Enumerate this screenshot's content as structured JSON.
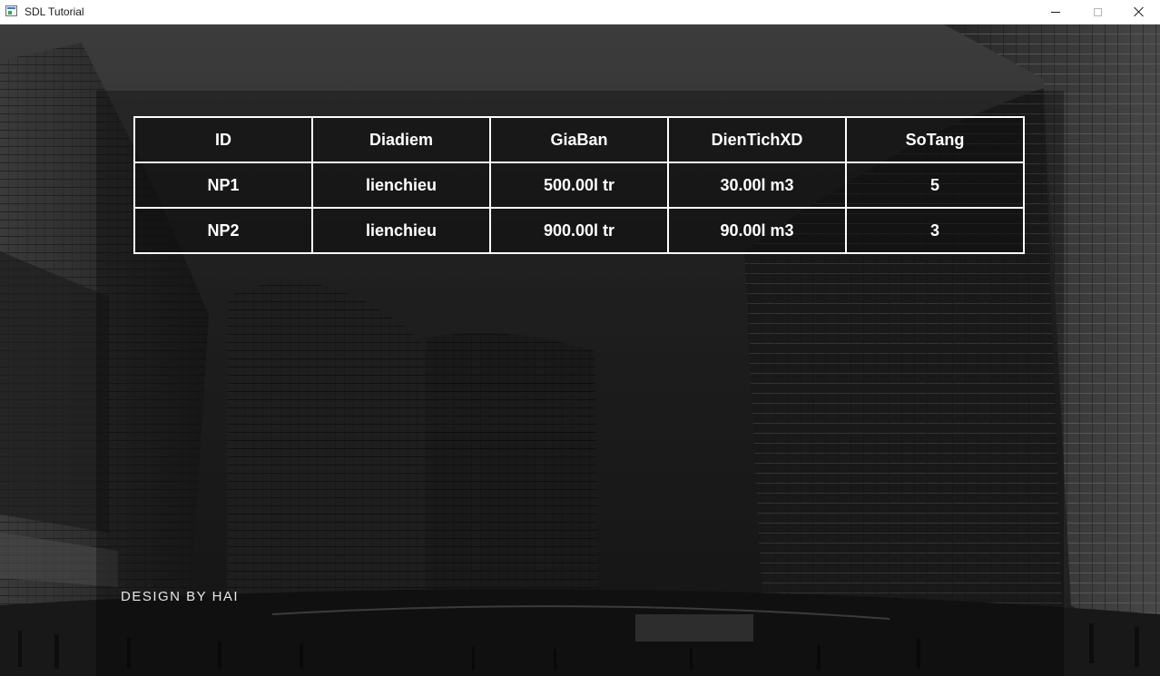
{
  "window": {
    "title": "SDL Tutorial"
  },
  "table": {
    "headers": [
      "ID",
      "Diadiem",
      "GiaBan",
      "DienTichXD",
      "SoTang"
    ],
    "rows": [
      [
        "NP1",
        "lienchieu",
        "500.00l tr",
        "30.00l m3",
        "5"
      ],
      [
        "NP2",
        "lienchieu",
        "900.00l tr",
        "90.00l m3",
        "3"
      ]
    ]
  },
  "footer": {
    "credit": "DESIGN BY HAI"
  },
  "colors": {
    "table_border": "#ffffff",
    "table_text": "#ffffff",
    "background_tone": "#2f2f2f"
  }
}
